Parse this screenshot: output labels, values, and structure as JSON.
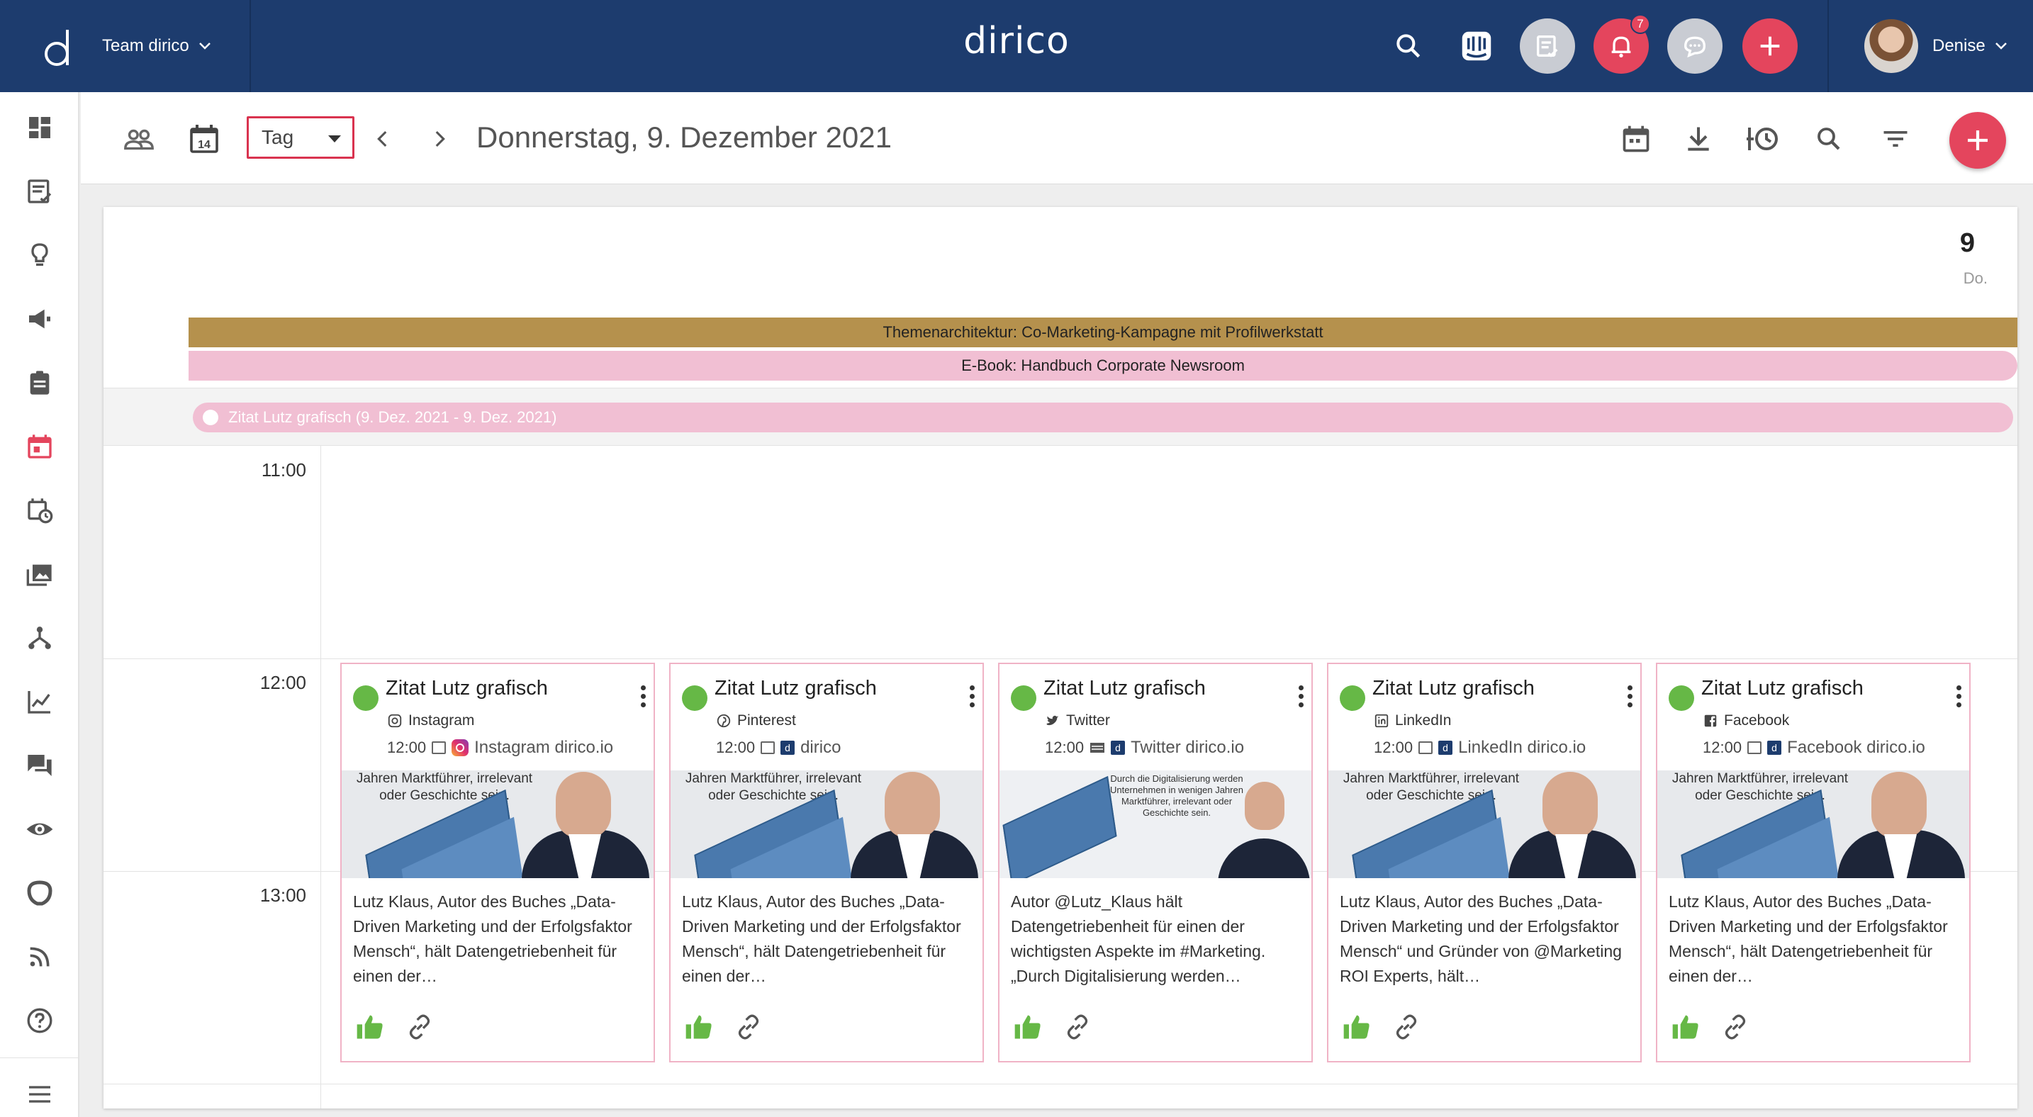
{
  "topbar": {
    "team_name": "Team dirico",
    "app_title": "dirico",
    "notification_count": "7",
    "user_name": "Denise",
    "brand_color": "#1d3c6e",
    "accent_color": "#e4455d"
  },
  "sidebar": {
    "items": [
      "dashboard-icon",
      "tasks-icon",
      "ideas-icon",
      "campaigns-icon",
      "briefings-icon",
      "calendar-icon",
      "schedule-icon",
      "media-icon",
      "workflow-icon",
      "analytics-icon",
      "comments-icon",
      "monitoring-icon",
      "brand-icon",
      "rss-icon",
      "help-icon",
      "menu-icon"
    ],
    "active": "calendar-icon"
  },
  "toolbar": {
    "date_badge": "14",
    "view_select": "Tag",
    "date_title": "Donnerstag, 9. Dezember 2021"
  },
  "calendar": {
    "day_number": "9",
    "day_name": "Do.",
    "all_day_events": [
      {
        "label": "Themenarchitektur: Co-Marketing-Kampagne mit Profilwerkstatt",
        "color": "#b5914d"
      },
      {
        "label": "E-Book: Handbuch Corporate Newsroom",
        "color": "#f1bfd3"
      }
    ],
    "multi_day_event": "Zitat Lutz grafisch  (9. Dez. 2021 - 9. Dez. 2021)",
    "times": [
      "11:00",
      "12:00",
      "13:00"
    ],
    "cards": [
      {
        "title": "Zitat Lutz grafisch",
        "platform": "Instagram",
        "time": "12:00",
        "account": "Instagram dirico.io",
        "image_text": "Jahren Marktführer, irrelevant oder Geschichte sein.",
        "text": "Lutz Klaus, Autor des Buches „Data-Driven Marketing und der Erfolgsfaktor Mensch“, hält Datengetriebenheit für einen der…"
      },
      {
        "title": "Zitat Lutz grafisch",
        "platform": "Pinterest",
        "time": "12:00",
        "account": "dirico",
        "image_text": "Jahren Marktführer, irrelevant oder Geschichte sein.",
        "text": "Lutz Klaus, Autor des Buches „Data-Driven Marketing und der Erfolgsfaktor Mensch“, hält Datengetriebenheit für einen der…"
      },
      {
        "title": "Zitat Lutz grafisch",
        "platform": "Twitter",
        "time": "12:00",
        "account": "Twitter dirico.io",
        "image_text": "Durch die Digitalisierung werden Unternehmen in wenigen Jahren Marktführer, irrelevant oder Geschichte sein.",
        "text": "Autor @Lutz_Klaus hält Datengetriebenheit für einen der wichtigsten Aspekte im #Marketing. „Durch Digitalisierung werden…"
      },
      {
        "title": "Zitat Lutz grafisch",
        "platform": "LinkedIn",
        "time": "12:00",
        "account": "LinkedIn dirico.io",
        "image_text": "Jahren Marktführer, irrelevant oder Geschichte sein.",
        "text": "Lutz Klaus, Autor des Buches „Data-Driven Marketing und der Erfolgsfaktor Mensch“ und Gründer von @Marketing ROI Experts, hält…"
      },
      {
        "title": "Zitat Lutz grafisch",
        "platform": "Facebook",
        "time": "12:00",
        "account": "Facebook dirico.io",
        "image_text": "Jahren Marktführer, irrelevant oder Geschichte sein.",
        "text": "Lutz Klaus, Autor des Buches „Data-Driven Marketing und der Erfolgsfaktor Mensch“, hält Datengetriebenheit für einen der…"
      }
    ]
  }
}
